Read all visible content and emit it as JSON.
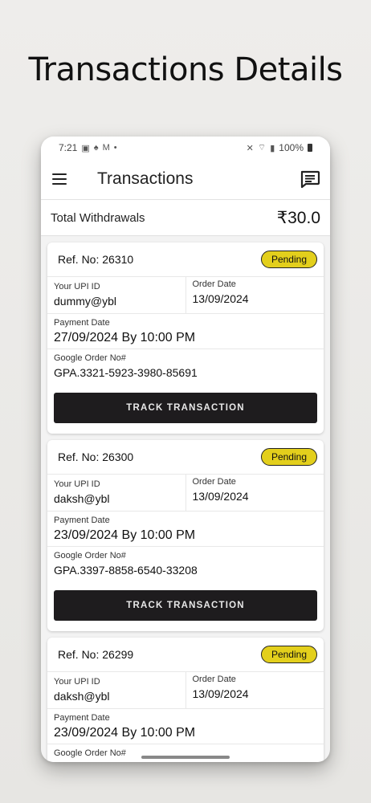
{
  "headline": "Transactions Details",
  "status_bar": {
    "time": "7:21",
    "battery": "100%"
  },
  "app_bar": {
    "title": "Transactions"
  },
  "summary": {
    "label": "Total Withdrawals",
    "amount": "₹30.0"
  },
  "labels": {
    "upi": "Your UPI ID",
    "order_date": "Order Date",
    "payment_date": "Payment Date",
    "google_order": "Google Order No#",
    "track": "TRACK TRANSACTION"
  },
  "transactions": [
    {
      "ref": "Ref. No: 26310",
      "status": "Pending",
      "upi_id": "dummy@ybl",
      "order_date": "13/09/2024",
      "payment_date": "27/09/2024 By 10:00 PM",
      "google_order_no": "GPA.3321-5923-3980-85691"
    },
    {
      "ref": "Ref. No: 26300",
      "status": "Pending",
      "upi_id": "daksh@ybl",
      "order_date": "13/09/2024",
      "payment_date": "23/09/2024 By 10:00 PM",
      "google_order_no": "GPA.3397-8858-6540-33208"
    },
    {
      "ref": "Ref. No: 26299",
      "status": "Pending",
      "upi_id": "daksh@ybl",
      "order_date": "13/09/2024",
      "payment_date": "23/09/2024 By 10:00 PM",
      "google_order_no": ""
    }
  ]
}
